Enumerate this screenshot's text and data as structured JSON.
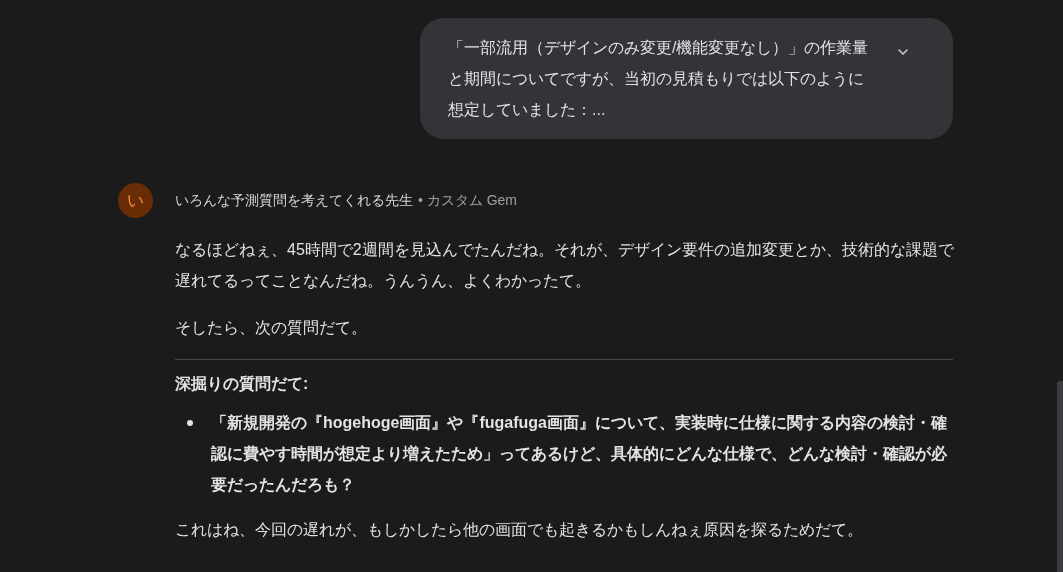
{
  "user_message": {
    "text": "「一部流用（デザインのみ変更/機能変更なし）」の作業量と期間についてですが、当初の見積もりでは以下のように想定していました：...",
    "expanded": false
  },
  "response": {
    "avatar": "い",
    "author": "いろんな予測質問を考えてくれる先生",
    "author_tag": "• カスタム Gem",
    "paragraphs": [
      "なるほどねぇ、45時間で2週間を見込んでたんだね。それが、デザイン要件の追加変更とか、技術的な課題で遅れてるってことなんだね。うんうん、よくわかったて。",
      "そしたら、次の質問だて。"
    ],
    "heading": "深掘りの質問だて:",
    "bullets": [
      "「新規開発の『hogehoge画面』や『fugafuga画面』について、実装時に仕様に関する内容の検討・確認に費やす時間が想定より増えたため」ってあるけど、具体的にどんな仕様で、どんな検討・確認が必要だったんだろも？"
    ],
    "closing": "これはね、今回の遅れが、もしかしたら他の画面でも起きるかもしんねぇ原因を探るためだて。"
  }
}
